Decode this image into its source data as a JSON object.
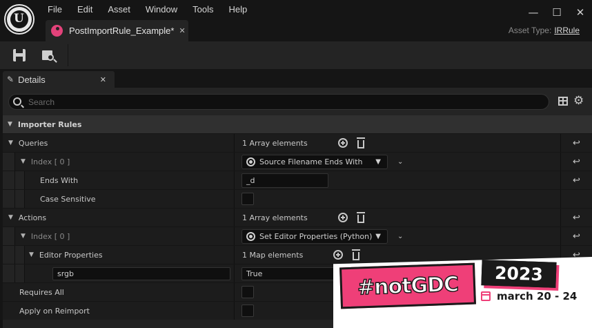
{
  "menu": [
    "File",
    "Edit",
    "Asset",
    "Window",
    "Tools",
    "Help"
  ],
  "window_controls": {
    "minimize": "—",
    "maximize": "☐",
    "close": "✕"
  },
  "doc_tab": {
    "label": "PostImportRule_Example*",
    "close": "✕"
  },
  "asset_type": {
    "label": "Asset Type:",
    "value": "IRRule"
  },
  "panel_tab": {
    "label": "Details",
    "close": "✕"
  },
  "search": {
    "placeholder": "Search"
  },
  "category": {
    "label": "Importer Rules"
  },
  "rows": {
    "queries": {
      "label": "Queries",
      "value": "1 Array elements"
    },
    "queries_index": {
      "label": "Index [ 0 ]",
      "combo": "Source Filename Ends With"
    },
    "ends_with": {
      "label": "Ends With",
      "value": "_d"
    },
    "case_sensitive": {
      "label": "Case Sensitive"
    },
    "actions": {
      "label": "Actions",
      "value": "1 Array elements"
    },
    "actions_index": {
      "label": "Index [ 0 ]",
      "combo": "Set Editor Properties (Python)"
    },
    "editor_properties": {
      "label": "Editor Properties",
      "value": "1 Map elements"
    },
    "map_entry": {
      "key": "srgb",
      "value": "True"
    },
    "requires_all": {
      "label": "Requires All"
    },
    "apply_on_reimport": {
      "label": "Apply on Reimport"
    }
  },
  "badge": {
    "title": "#notGDC",
    "year": "2023",
    "dates": "march 20 - 24"
  },
  "colors": {
    "accent_pink": "#ef3f78",
    "panel_bg": "#242424",
    "window_bg": "#151515"
  },
  "icons": [
    "unreal-logo",
    "save-icon",
    "browse-icon",
    "pencil-icon",
    "search-icon",
    "view-options-icon",
    "gear-icon",
    "add-icon",
    "trash-icon",
    "reset-icon",
    "combo-icon",
    "calendar-icon"
  ]
}
